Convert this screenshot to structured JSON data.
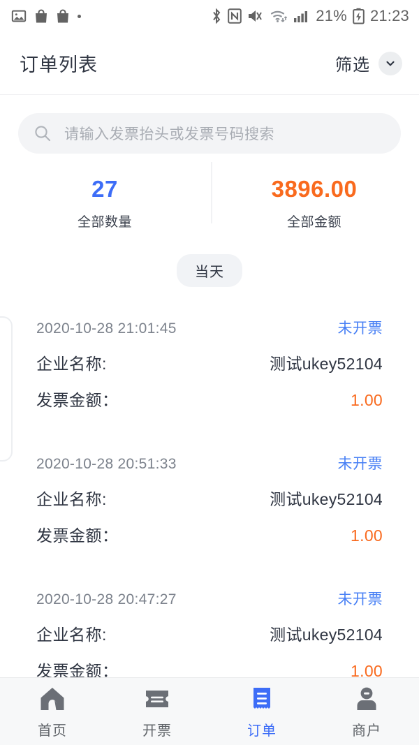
{
  "statusbar": {
    "left_icons": [
      "image-icon",
      "shopping-bag-icon",
      "shopping-bag-icon",
      "dot-indicator"
    ],
    "right_icons": [
      "bluetooth-icon",
      "nfc-icon",
      "vibrate-mute-icon",
      "wifi-icon",
      "cellular-signal-icon",
      "battery-charging-icon"
    ],
    "battery_percent": "21%",
    "clock": "21:23"
  },
  "header": {
    "title": "订单列表",
    "filter_label": "筛选",
    "filter_icon": "chevron-down-icon"
  },
  "search": {
    "icon": "search-icon",
    "value": "",
    "placeholder": "请输入发票抬头或发票号码搜索"
  },
  "stats": {
    "count_value": "27",
    "count_label": "全部数量",
    "amount_value": "3896.00",
    "amount_label": "全部金额",
    "count_color": "#3d6df7",
    "amount_color": "#f96a1e"
  },
  "group": {
    "chip_label": "当天"
  },
  "labels": {
    "company": "企业名称:",
    "amount": "发票金额："
  },
  "orders": [
    {
      "timestamp": "2020-10-28 21:01:45",
      "status": "未开票",
      "company": "测试ukey52104",
      "amount": "1.00"
    },
    {
      "timestamp": "2020-10-28 20:51:33",
      "status": "未开票",
      "company": "测试ukey52104",
      "amount": "1.00"
    },
    {
      "timestamp": "2020-10-28 20:47:27",
      "status": "未开票",
      "company": "测试ukey52104",
      "amount": "1.00"
    }
  ],
  "tabbar": {
    "items": [
      {
        "label": "首页",
        "icon": "home-icon",
        "active": false
      },
      {
        "label": "开票",
        "icon": "ticket-icon",
        "active": false
      },
      {
        "label": "订单",
        "icon": "receipt-icon",
        "active": true
      },
      {
        "label": "商户",
        "icon": "person-icon",
        "active": false
      }
    ],
    "active_color": "#3d6df7",
    "inactive_color": "#6b6f76"
  }
}
